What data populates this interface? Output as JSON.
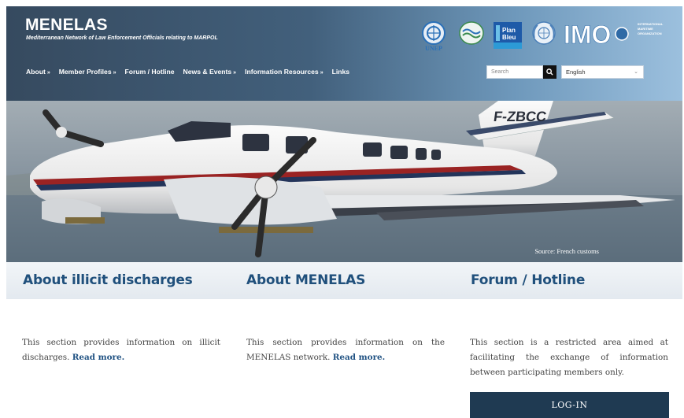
{
  "header": {
    "title": "MENELAS",
    "subtitle": "Mediterranean Network of Law Enforcement Officials relating to MARPOL",
    "nav": [
      {
        "label": "About",
        "chevron": "»"
      },
      {
        "label": "Member Profiles",
        "chevron": "»"
      },
      {
        "label": "Forum / Hotline",
        "chevron": ""
      },
      {
        "label": "News & Events",
        "chevron": "»"
      },
      {
        "label": "Information Resources",
        "chevron": "»"
      },
      {
        "label": "Links",
        "chevron": ""
      }
    ],
    "search_placeholder": "Search",
    "language": "English",
    "logos": {
      "unep_label": "UNEP",
      "plan_bleu_lines": [
        "Plan",
        "Bleu"
      ],
      "imo_text": "IMO",
      "imo_sub_lines": [
        "INTERNATIONAL",
        "MARITIME",
        "ORGANIZATION"
      ]
    }
  },
  "hero": {
    "tail_number": "F-ZBCC",
    "caption": "Source: French customs"
  },
  "columns": [
    {
      "title": "About illicit discharges",
      "text": "This section provides information on illicit discharges.",
      "link": "Read more."
    },
    {
      "title": "About MENELAS",
      "text": "This section provides information on the MENELAS network.",
      "link": "Read more."
    },
    {
      "title": "Forum / Hotline",
      "text": "This section is a restricted area aimed at facilitating the exchange of information between participating members only.",
      "button": "LOG-IN"
    }
  ],
  "icons": [
    "search-icon",
    "chevron-down-icon",
    "unep-logo",
    "wave-logo",
    "plan-bleu-logo",
    "un-logo",
    "imo-logo"
  ],
  "colors": {
    "accent": "#20507c",
    "button_bg": "#1f3a52",
    "header_dark": "#364a5f"
  }
}
